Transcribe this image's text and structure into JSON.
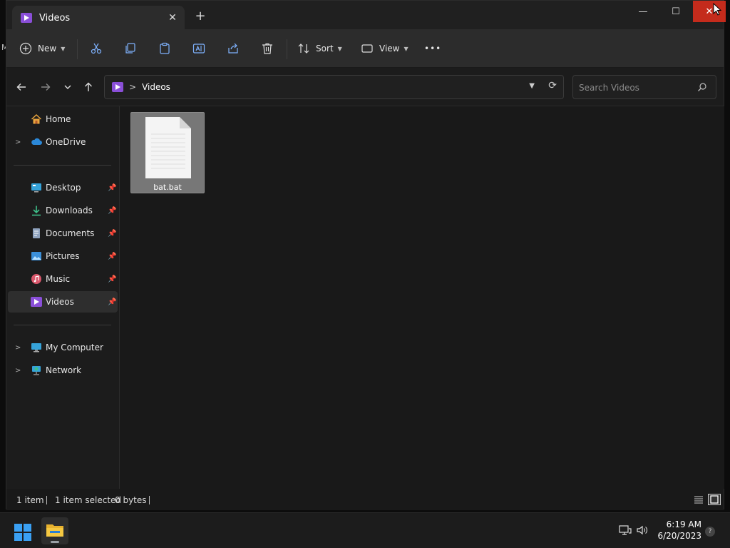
{
  "desktop": {
    "stray_label": "M"
  },
  "window": {
    "tab_title": "Videos",
    "tab_icon": "videos-folder-icon",
    "new_tab_label": "+",
    "controls": {
      "minimize": "—",
      "maximize": "☐",
      "close": "✕"
    }
  },
  "toolbar": {
    "new_label": "New",
    "sort_label": "Sort",
    "view_label": "View",
    "more_label": "•••",
    "icons": [
      "cut-icon",
      "copy-icon",
      "paste-icon",
      "rename-icon",
      "share-icon",
      "delete-icon"
    ]
  },
  "address": {
    "separator": ">",
    "path": "Videos",
    "search_placeholder": "Search Videos"
  },
  "sidebar": {
    "items": [
      {
        "label": "Home",
        "icon": "home-icon",
        "expandable": false,
        "pinned": false
      },
      {
        "label": "OneDrive",
        "icon": "cloud-icon",
        "expandable": true,
        "pinned": false
      },
      {
        "label": "Desktop",
        "icon": "desktop-icon",
        "expandable": false,
        "pinned": true
      },
      {
        "label": "Downloads",
        "icon": "download-icon",
        "expandable": false,
        "pinned": true
      },
      {
        "label": "Documents",
        "icon": "documents-icon",
        "expandable": false,
        "pinned": true
      },
      {
        "label": "Pictures",
        "icon": "pictures-icon",
        "expandable": false,
        "pinned": true
      },
      {
        "label": "Music",
        "icon": "music-icon",
        "expandable": false,
        "pinned": true
      },
      {
        "label": "Videos",
        "icon": "videos-icon",
        "expandable": false,
        "pinned": true,
        "selected": true
      },
      {
        "label": "My Computer",
        "icon": "computer-icon",
        "expandable": true,
        "pinned": false
      },
      {
        "label": "Network",
        "icon": "network-icon",
        "expandable": true,
        "pinned": false
      }
    ]
  },
  "files": [
    {
      "name": "bat.bat",
      "icon": "text-file-icon",
      "selected": true
    }
  ],
  "status": {
    "item_count": "1 item",
    "selection": "1 item selected",
    "size": "0 bytes"
  },
  "taskbar": {
    "time": "6:19 AM",
    "date": "6/20/2023",
    "notification": "?"
  },
  "colors": {
    "close_button": "#c42b1c",
    "accent_videos": "#8a4fd8",
    "selection_bg": "#777777"
  }
}
